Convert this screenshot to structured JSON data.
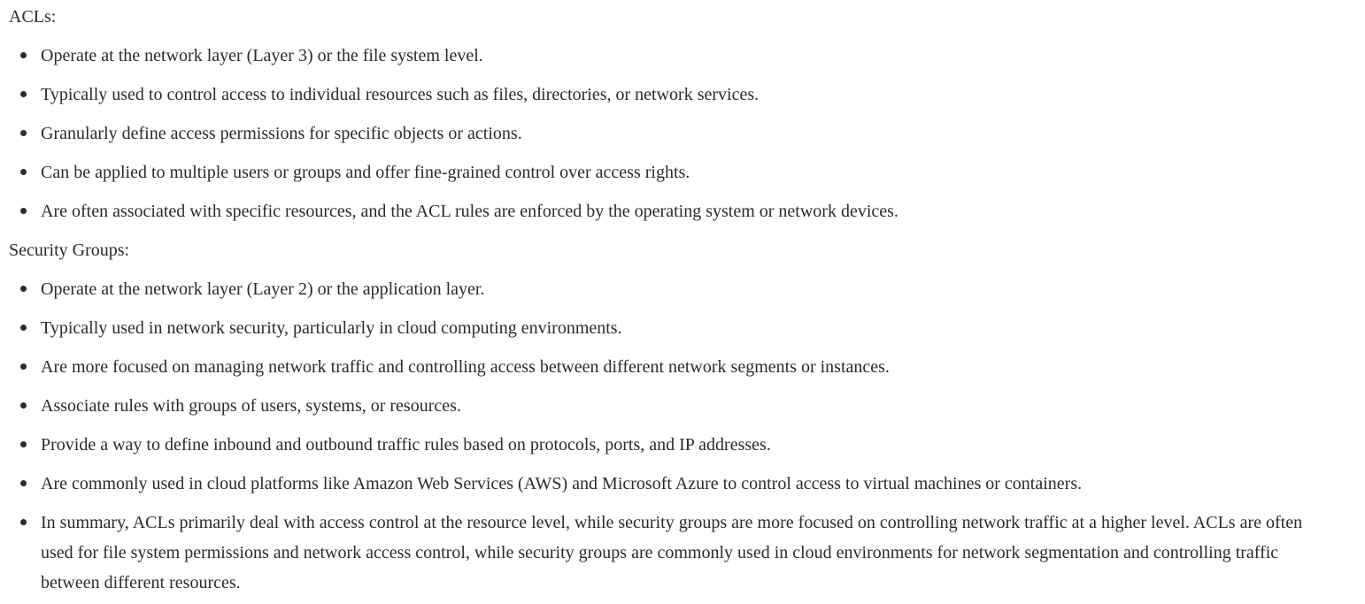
{
  "acls": {
    "heading": "ACLs:",
    "items": [
      "Operate at the network layer (Layer 3) or the file system level.",
      "Typically used to control access to individual resources such as files, directories, or network services.",
      "Granularly define access permissions for specific objects or actions.",
      "Can be applied to multiple users or groups and offer fine-grained control over access rights.",
      "Are often associated with specific resources, and the ACL rules are enforced by the operating system or network devices."
    ]
  },
  "security_groups": {
    "heading": "Security Groups:",
    "items": [
      "Operate at the network layer (Layer 2) or the application layer.",
      "Typically used in network security, particularly in cloud computing environments.",
      "Are more focused on managing network traffic and controlling access between different network segments or instances.",
      "Associate rules with groups of users, systems, or resources.",
      "Provide a way to define inbound and outbound traffic rules based on protocols, ports, and IP addresses.",
      "Are commonly used in cloud platforms like Amazon Web Services (AWS) and Microsoft Azure to control access to virtual machines or containers.",
      "In summary, ACLs primarily deal with access control at the resource level, while security groups are more focused on controlling network traffic at a higher level. ACLs are often used for file system permissions and network access control, while security groups are commonly used in cloud environments for network segmentation and controlling traffic between different resources."
    ]
  }
}
